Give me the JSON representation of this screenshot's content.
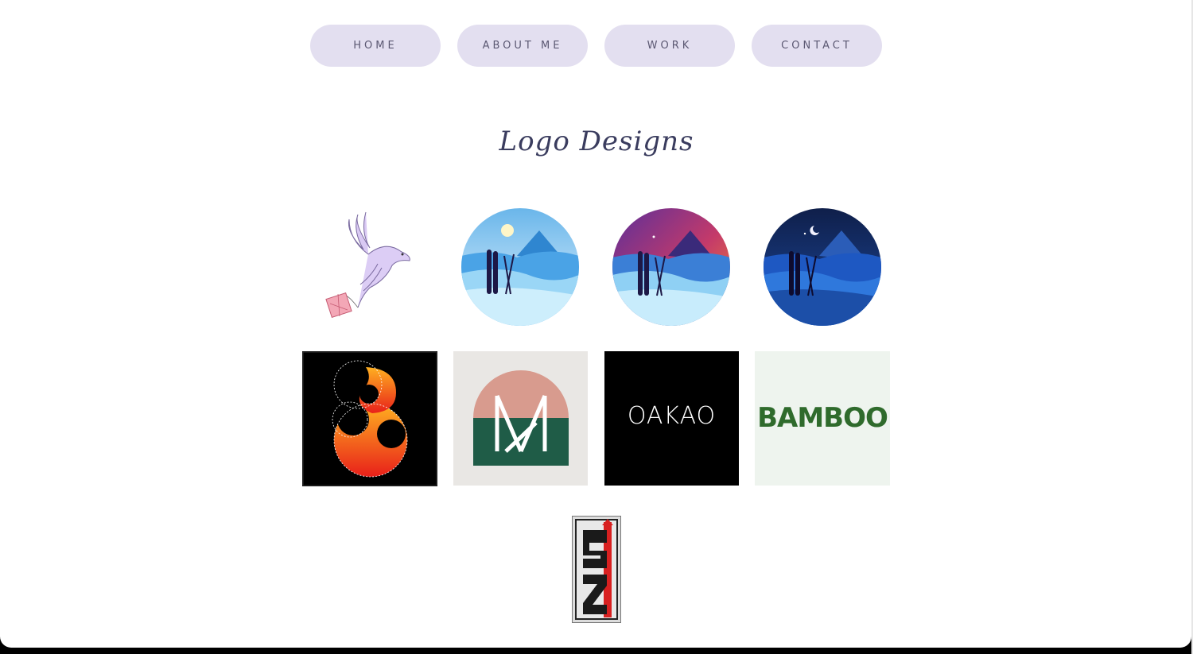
{
  "nav": {
    "items": [
      {
        "label": "HOME"
      },
      {
        "label": "ABOUT ME"
      },
      {
        "label": "WORK"
      },
      {
        "label": "CONTACT"
      }
    ]
  },
  "page_title": "Logo Designs",
  "logos": {
    "oakao_text": "OAKAO",
    "bamboo_text": "BAMBOO"
  },
  "colors": {
    "nav_bg": "#e3dff0",
    "nav_text": "#5b5872",
    "title": "#3a3c5e",
    "bamboo_green": "#2f6b2c"
  },
  "icons": {
    "bird": "bird-gift-icon",
    "ski_day": "ski-day-icon",
    "ski_sunset": "ski-sunset-icon",
    "ski_night": "ski-night-icon",
    "flame_eight": "flame-eight-icon",
    "m_arch": "m-arch-icon",
    "sz": "sz-icon"
  }
}
